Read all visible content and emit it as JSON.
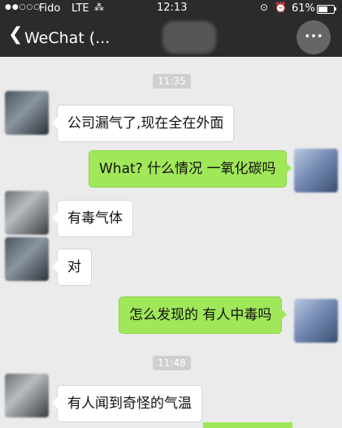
{
  "status_bar": {
    "signal": "●●○○○",
    "carrier": "Fido",
    "network": "LTE",
    "activity_icon": "activity-spinner",
    "time": "12:13",
    "rotation_icon": "rotation-lock",
    "alarm_icon": "alarm-clock",
    "battery": "61%",
    "battery_level": 0.61
  },
  "nav": {
    "back_icon": "chevron-left",
    "title": "WeChat (...",
    "more": "•••"
  },
  "messages": {
    "time1": "11:35",
    "m1": "公司漏气了,现在全在外面",
    "m2": "What? 什么情况 一氧化碳吗",
    "m3": "有毒气体",
    "m4": "对",
    "m5": "怎么发现的 有人中毒吗",
    "time2": "11:48",
    "m6": "有人闻到奇怪的气温"
  },
  "colors": {
    "outgoing_bubble": "#a0e75a",
    "incoming_bubble": "#ffffff",
    "background": "#ebebeb",
    "bars": "#2b2b2d"
  }
}
